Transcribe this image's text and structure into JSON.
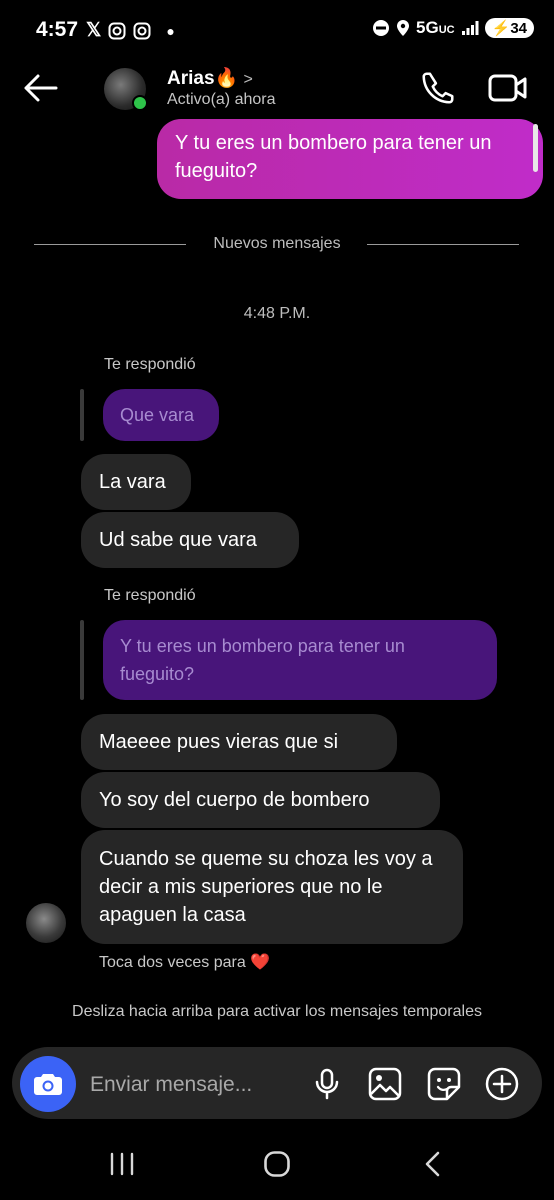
{
  "status_bar": {
    "time": "4:57",
    "network": "5G",
    "network_sub": "UC",
    "battery": "34"
  },
  "header": {
    "contact_name": "Arias🔥",
    "name_chevron": ">",
    "status": "Activo(a) ahora"
  },
  "messages": {
    "sent_top": "Y tu eres un bombero para tener un fueguito?",
    "divider": "Nuevos mensajes",
    "timestamp": "4:48 P.M.",
    "reply_label_1": "Te respondió",
    "quoted_1": "Que vara",
    "recv_1": "La vara",
    "recv_2": "Ud sabe que vara",
    "reply_label_2": "Te respondió",
    "quoted_2": "Y tu eres un bombero para tener un fueguito?",
    "recv_3": "Maeeee pues vieras que si",
    "recv_4": "Yo soy del cuerpo de bombero",
    "recv_5": "Cuando se queme su choza les voy a decir a mis superiores que no le apaguen la casa",
    "hint": "Toca dos veces para",
    "hint_heart": "❤️",
    "ephemeral_hint": "Desliza hacia arriba para activar los mensajes temporales"
  },
  "composer": {
    "placeholder": "Enviar mensaje..."
  },
  "colors": {
    "sent_bubble": "#c02cc9",
    "quoted_bubble": "#48157a",
    "received_bubble": "#262626",
    "camera_button": "#3b63f6",
    "online_dot": "#2ec34a"
  }
}
